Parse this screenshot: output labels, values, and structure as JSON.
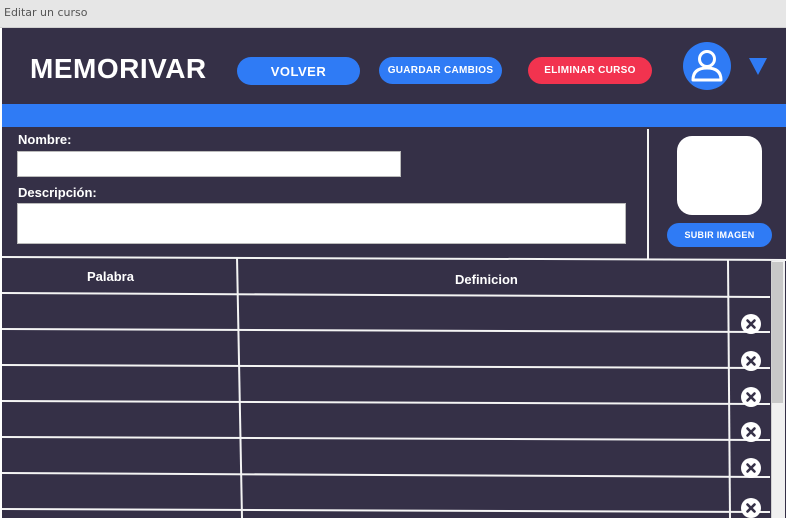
{
  "window": {
    "title": "Editar un curso"
  },
  "header": {
    "logo": "MEMORIVAR",
    "buttons": {
      "back": "VOLVER",
      "save": "GUARDAR CAMBIOS",
      "delete": "ELIMINAR CURSO"
    },
    "avatar_icon": "user-icon",
    "menu_icon": "caret-down-icon"
  },
  "form": {
    "name_label": "Nombre:",
    "name_value": "",
    "description_label": "Descripción:",
    "description_value": "",
    "upload_button": "SUBIR IMAGEN"
  },
  "table": {
    "columns": [
      "Palabra",
      "Definicion"
    ],
    "rows": [
      {
        "word": "",
        "definition": ""
      },
      {
        "word": "",
        "definition": ""
      },
      {
        "word": "",
        "definition": ""
      },
      {
        "word": "",
        "definition": ""
      },
      {
        "word": "",
        "definition": ""
      },
      {
        "word": "",
        "definition": ""
      }
    ],
    "row_action_icon": "remove-icon"
  },
  "colors": {
    "background": "#353047",
    "accent_blue": "#2f7bf5",
    "danger_red": "#f2334f",
    "titlebar": "#e6e6e6"
  }
}
